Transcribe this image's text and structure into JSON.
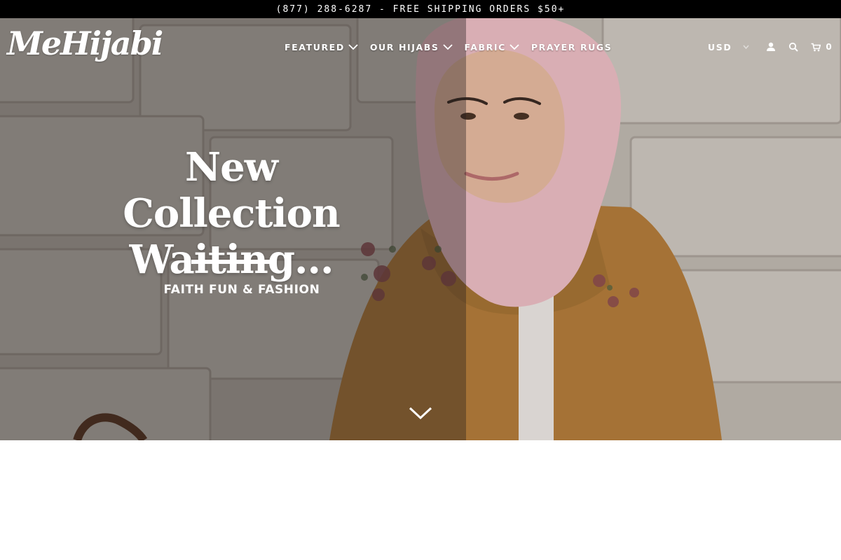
{
  "announcement": "(877) 288-6287 - FREE SHIPPING ORDERS $50+",
  "brand": {
    "logo_text": "MeHijabi"
  },
  "nav": {
    "items": [
      {
        "label": "FEATURED",
        "has_dropdown": true
      },
      {
        "label": "OUR HIJABS",
        "has_dropdown": true
      },
      {
        "label": "FABRIC",
        "has_dropdown": true
      },
      {
        "label": "PRAYER RUGS",
        "has_dropdown": false
      }
    ]
  },
  "utility": {
    "currency": "USD",
    "icons": [
      "user-icon",
      "search-icon",
      "cart-icon"
    ],
    "cart_count": "0"
  },
  "hero": {
    "headline_line1": "New Collection",
    "headline_line2": "Waiting...",
    "tagline": "FAITH FUN & FASHION",
    "scroll_icon": "chevron-down-icon"
  },
  "colors": {
    "topbar_bg": "#000000",
    "text": "#ffffff",
    "jacket": "#b07a3a",
    "hijab": "#e7b9c0",
    "wall": "#bdb6ae"
  }
}
